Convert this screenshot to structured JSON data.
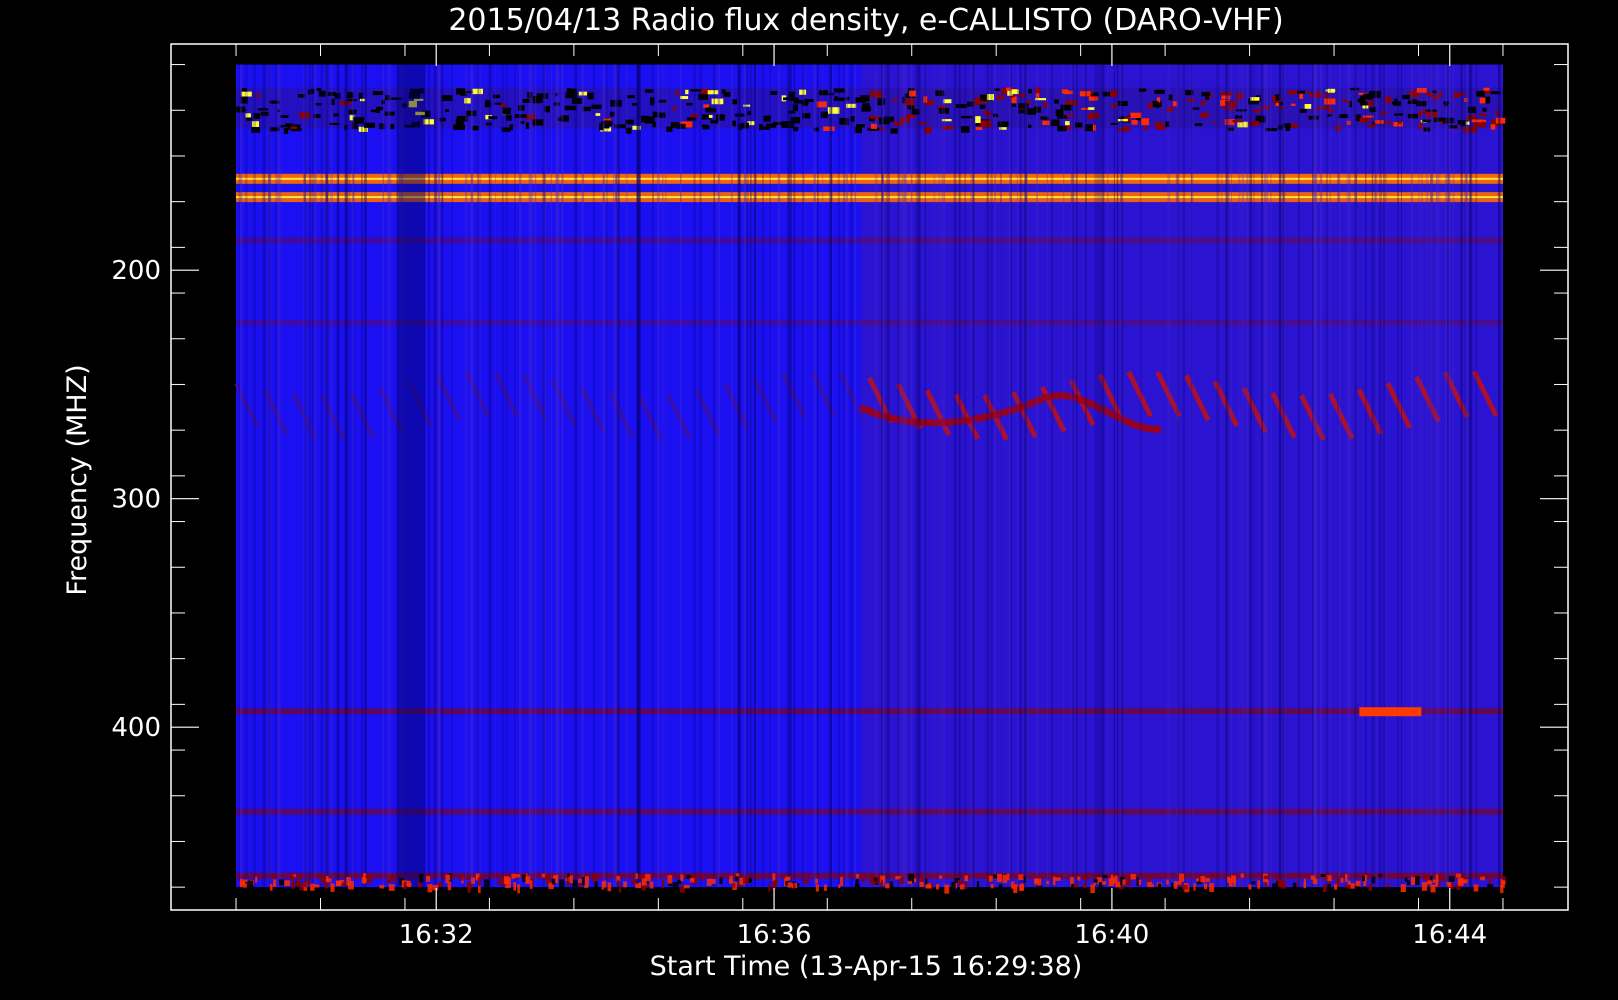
{
  "chart_data": {
    "type": "heatmap",
    "title": "2015/04/13  Radio flux density, e-CALLISTO (DARO-VHF)",
    "xlabel": "Start Time (13-Apr-15 16:29:38)",
    "ylabel": "Frequency (MHZ)",
    "x_ticks": [
      {
        "label": "16:32",
        "minutes": 2.37
      },
      {
        "label": "16:36",
        "minutes": 6.37
      },
      {
        "label": "16:40",
        "minutes": 10.37
      },
      {
        "label": "16:44",
        "minutes": 14.37
      }
    ],
    "y_ticks": [
      {
        "label": "200",
        "mhz": 200
      },
      {
        "label": "300",
        "mhz": 300
      },
      {
        "label": "400",
        "mhz": 400
      }
    ],
    "x_range_minutes": [
      -0.77,
      15.77
    ],
    "y_range_mhz": [
      101,
      480
    ],
    "data_extent": {
      "t_start_min": 0,
      "t_end_min": 15,
      "f_top_mhz": 110,
      "f_bottom_mhz": 470
    },
    "colormap": [
      "#000000",
      "#1a1aff",
      "#8b0000",
      "#ff2a00",
      "#ffff00"
    ],
    "background_color": "#1a10f2",
    "level_change_minutes": 7.4,
    "features": {
      "horizontal_bands_mhz": [
        {
          "f": 160,
          "intensity": 0.95
        },
        {
          "f": 168,
          "intensity": 0.9
        },
        {
          "f": 187,
          "intensity": 0.35
        },
        {
          "f": 223,
          "intensity": 0.3
        },
        {
          "f": 393,
          "intensity": 0.6
        },
        {
          "f": 437,
          "intensity": 0.55
        },
        {
          "f": 465,
          "intensity": 0.7
        }
      ],
      "interference_band_mhz": [
        120,
        138
      ],
      "drifting_structure_mhz": [
        245,
        275
      ]
    }
  }
}
